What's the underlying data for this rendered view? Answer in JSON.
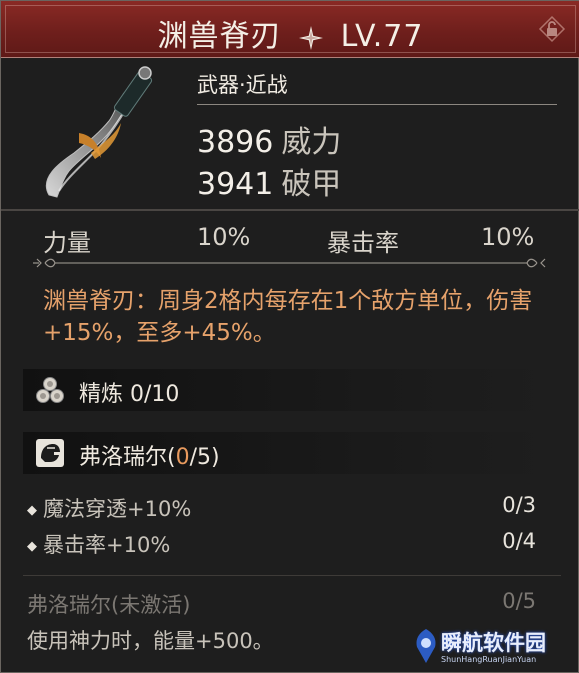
{
  "header": {
    "name": "渊兽脊刃",
    "level": "LV.77",
    "star_icon": "four-point-star-icon",
    "lock_icon": "lock-icon"
  },
  "item": {
    "category": "武器·近战",
    "power_value": "3896",
    "power_label": "威力",
    "pierce_value": "3941",
    "pierce_label": "破甲"
  },
  "substats": [
    {
      "label": "力量",
      "value": "10%"
    },
    {
      "label": "暴击率",
      "value": "10%"
    }
  ],
  "skill": {
    "text": "渊兽脊刃：周身2格内每存在1个敌方单位，伤害+15%，至多+45%。"
  },
  "refine": {
    "label": "精炼 0/10",
    "icon": "refine-gems-icon"
  },
  "set": {
    "name": "弗洛瑞尔(",
    "count": "0",
    "total": "/5)",
    "icon": "helmet-icon",
    "perks": [
      {
        "label": "魔法穿透+10%",
        "progress": "0/3"
      },
      {
        "label": "暴击率+10%",
        "progress": "0/4"
      }
    ],
    "inactive_label": "弗洛瑞尔(未激活)",
    "inactive_progress": "0/5",
    "inactive_desc": "使用神力时，能量+500。"
  },
  "watermark": {
    "title": "瞬航软件园",
    "subtitle": "ShunHangRuanJianYuan"
  },
  "colors": {
    "header": "#7a2420",
    "skill_text": "#e6a26b",
    "accent_orange": "#e89a5e"
  }
}
